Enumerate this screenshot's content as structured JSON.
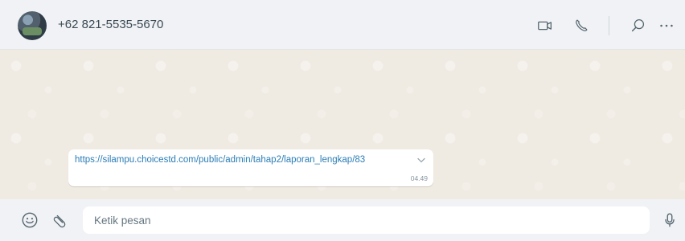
{
  "header": {
    "contact_name": "+62 821-5535-5670",
    "icons": {
      "avatar": "contact-avatar",
      "video": "video-call-icon",
      "voice": "voice-call-icon",
      "search": "search-icon",
      "menu": "more-options-icon"
    }
  },
  "message": {
    "text": "https://silampu.choicestd.com/public/admin/tahap2/laporan_lengkap/83",
    "time": "04.49",
    "menu_icon": "chevron-down-icon"
  },
  "composer": {
    "placeholder": "Ketik pesan",
    "value": "",
    "icons": {
      "emoji": "emoji-icon",
      "attach": "paperclip-icon",
      "mic": "microphone-icon"
    }
  },
  "colors": {
    "header_bg": "#f0f2f5",
    "chat_bg": "#efeae2",
    "bubble_bg": "#ffffff",
    "link": "#2b7db6",
    "icon": "#54656f"
  }
}
